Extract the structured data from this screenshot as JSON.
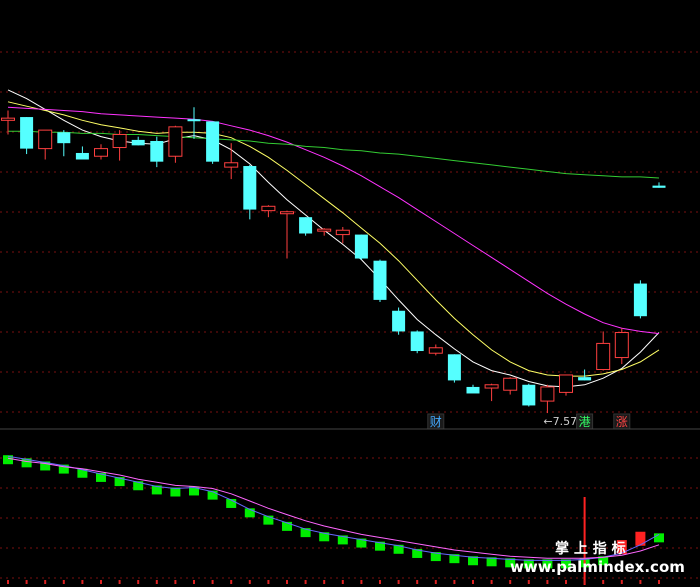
{
  "chart_data": [
    {
      "type": "candlestick",
      "panel": "price",
      "ylim": [
        7.2,
        10.6
      ],
      "grid": true,
      "candles": [
        {
          "o": 9.77,
          "h": 9.86,
          "l": 9.64,
          "c": 9.79
        },
        {
          "o": 9.8,
          "h": 9.8,
          "l": 9.46,
          "c": 9.51
        },
        {
          "o": 9.51,
          "h": 9.66,
          "l": 9.41,
          "c": 9.68
        },
        {
          "o": 9.66,
          "h": 9.68,
          "l": 9.44,
          "c": 9.56
        },
        {
          "o": 9.47,
          "h": 9.53,
          "l": 9.41,
          "c": 9.41
        },
        {
          "o": 9.44,
          "h": 9.55,
          "l": 9.41,
          "c": 9.51
        },
        {
          "o": 9.52,
          "h": 9.68,
          "l": 9.4,
          "c": 9.64
        },
        {
          "o": 9.59,
          "h": 9.62,
          "l": 9.54,
          "c": 9.54
        },
        {
          "o": 9.58,
          "h": 9.62,
          "l": 9.34,
          "c": 9.39
        },
        {
          "o": 9.44,
          "h": 9.72,
          "l": 9.38,
          "c": 9.71
        },
        {
          "o": 9.78,
          "h": 9.89,
          "l": 9.6,
          "c": 9.77
        },
        {
          "o": 9.76,
          "h": 9.76,
          "l": 9.37,
          "c": 9.39
        },
        {
          "o": 9.34,
          "h": 9.56,
          "l": 9.23,
          "c": 9.38
        },
        {
          "o": 9.35,
          "h": 9.36,
          "l": 8.86,
          "c": 8.95
        },
        {
          "o": 8.94,
          "h": 8.99,
          "l": 8.88,
          "c": 8.98
        },
        {
          "o": 8.92,
          "h": 8.94,
          "l": 8.5,
          "c": 8.93
        },
        {
          "o": 8.88,
          "h": 8.88,
          "l": 8.71,
          "c": 8.73
        },
        {
          "o": 8.76,
          "h": 8.78,
          "l": 8.71,
          "c": 8.77
        },
        {
          "o": 8.72,
          "h": 8.79,
          "l": 8.64,
          "c": 8.76
        },
        {
          "o": 8.72,
          "h": 8.72,
          "l": 8.49,
          "c": 8.5
        },
        {
          "o": 8.48,
          "h": 8.49,
          "l": 8.1,
          "c": 8.12
        },
        {
          "o": 8.02,
          "h": 8.05,
          "l": 7.8,
          "c": 7.83
        },
        {
          "o": 7.83,
          "h": 7.84,
          "l": 7.63,
          "c": 7.65
        },
        {
          "o": 7.63,
          "h": 7.71,
          "l": 7.61,
          "c": 7.68
        },
        {
          "o": 7.62,
          "h": 7.62,
          "l": 7.36,
          "c": 7.38
        },
        {
          "o": 7.32,
          "h": 7.34,
          "l": 7.29,
          "c": 7.26
        },
        {
          "o": 7.31,
          "h": 7.35,
          "l": 7.19,
          "c": 7.34
        },
        {
          "o": 7.29,
          "h": 7.41,
          "l": 7.25,
          "c": 7.4
        },
        {
          "o": 7.34,
          "h": 7.35,
          "l": 7.14,
          "c": 7.15
        },
        {
          "o": 7.19,
          "h": 7.34,
          "l": 7.08,
          "c": 7.32
        },
        {
          "o": 7.27,
          "h": 7.43,
          "l": 7.24,
          "c": 7.43
        },
        {
          "o": 7.41,
          "h": 7.48,
          "l": 7.38,
          "c": 7.38
        },
        {
          "o": 7.48,
          "h": 7.83,
          "l": 7.47,
          "c": 7.72
        },
        {
          "o": 7.59,
          "h": 7.86,
          "l": 7.53,
          "c": 7.82
        },
        {
          "o": 8.27,
          "h": 8.3,
          "l": 7.95,
          "c": 7.97
        },
        {
          "o": 9.17,
          "h": 9.2,
          "l": 9.15,
          "c": 9.15
        }
      ],
      "series": [
        {
          "color": "#ffffff",
          "values": [
            10.05,
            9.97,
            9.87,
            9.77,
            9.68,
            9.62,
            9.58,
            9.56,
            9.55,
            9.6,
            9.63,
            9.59,
            9.5,
            9.37,
            9.2,
            9.04,
            8.9,
            8.76,
            8.63,
            8.49,
            8.31,
            8.12,
            7.94,
            7.8,
            7.67,
            7.55,
            7.47,
            7.43,
            7.37,
            7.33,
            7.32,
            7.34,
            7.4,
            7.49,
            7.64,
            7.82
          ]
        },
        {
          "color": "#ffff66",
          "values": [
            9.94,
            9.9,
            9.86,
            9.82,
            9.77,
            9.73,
            9.7,
            9.67,
            9.65,
            9.66,
            9.66,
            9.65,
            9.61,
            9.53,
            9.43,
            9.31,
            9.18,
            9.05,
            8.92,
            8.78,
            8.64,
            8.48,
            8.3,
            8.12,
            7.95,
            7.8,
            7.66,
            7.55,
            7.47,
            7.43,
            7.42,
            7.42,
            7.44,
            7.48,
            7.55,
            7.66
          ]
        },
        {
          "color": "#ff33ff",
          "values": [
            9.89,
            9.88,
            9.87,
            9.86,
            9.85,
            9.83,
            9.82,
            9.81,
            9.8,
            9.79,
            9.78,
            9.76,
            9.72,
            9.68,
            9.63,
            9.57,
            9.5,
            9.43,
            9.35,
            9.26,
            9.16,
            9.06,
            8.95,
            8.84,
            8.73,
            8.62,
            8.51,
            8.4,
            8.29,
            8.18,
            8.08,
            7.99,
            7.91,
            7.86,
            7.83,
            7.81
          ]
        },
        {
          "color": "#33cc33",
          "values": [
            9.67,
            9.67,
            9.66,
            9.66,
            9.65,
            9.65,
            9.64,
            9.64,
            9.63,
            9.62,
            9.61,
            9.6,
            9.59,
            9.58,
            9.56,
            9.55,
            9.53,
            9.52,
            9.5,
            9.49,
            9.47,
            9.46,
            9.44,
            9.42,
            9.4,
            9.38,
            9.36,
            9.34,
            9.32,
            9.3,
            9.28,
            9.27,
            9.26,
            9.25,
            9.25,
            9.24
          ]
        }
      ],
      "annotations": {
        "low_label": "←7.57"
      },
      "signals": [
        {
          "text": "财",
          "bar": 23,
          "fg": "#44aaff"
        },
        {
          "text": "港",
          "bar": 31,
          "fg": "#33ff66"
        },
        {
          "text": "涨",
          "bar": 33,
          "fg": "#ff4444"
        }
      ],
      "colors": {
        "up": "#ff4040",
        "down": "#55ffff"
      }
    },
    {
      "type": "bar",
      "panel": "indicator",
      "values": [
        15,
        12,
        9,
        6,
        2,
        -2,
        -6,
        -10,
        -14,
        -16,
        -15,
        -19,
        -27,
        -36,
        -43,
        -49,
        -55,
        -59,
        -62,
        -65,
        -68,
        -71,
        -75,
        -78,
        -80,
        -82,
        -83,
        -84,
        -85,
        -85,
        -85,
        -84,
        -82,
        -78,
        -70,
        -60
      ],
      "lines": [
        {
          "color": "#6666ff",
          "values": [
            14,
            11,
            8,
            5,
            1,
            -3,
            -7,
            -11,
            -15,
            -17,
            -16,
            -20,
            -28,
            -37,
            -44,
            -50,
            -56,
            -60,
            -63,
            -66,
            -69,
            -72,
            -76,
            -79,
            -81,
            -83,
            -84,
            -85,
            -86,
            -86,
            -86,
            -85,
            -83,
            -79,
            -71,
            -61
          ]
        },
        {
          "color": "#ff66ff",
          "values": [
            12,
            9,
            7,
            4,
            2,
            -1,
            -4,
            -8,
            -11,
            -14,
            -15,
            -17,
            -22,
            -29,
            -36,
            -42,
            -48,
            -53,
            -57,
            -61,
            -64,
            -67,
            -70,
            -73,
            -76,
            -78,
            -80,
            -82,
            -83,
            -84,
            -84,
            -84,
            -83,
            -81,
            -77,
            -71
          ]
        }
      ],
      "spike": {
        "bar": 31,
        "color": "#ff2222"
      },
      "red_bars_at": [
        33,
        34
      ],
      "colors": {
        "bar": "#00ee00",
        "red": "#ff2222"
      }
    }
  ],
  "watermark": {
    "line1": "掌 上 指 标",
    "line2": "www.palmindex.com"
  }
}
